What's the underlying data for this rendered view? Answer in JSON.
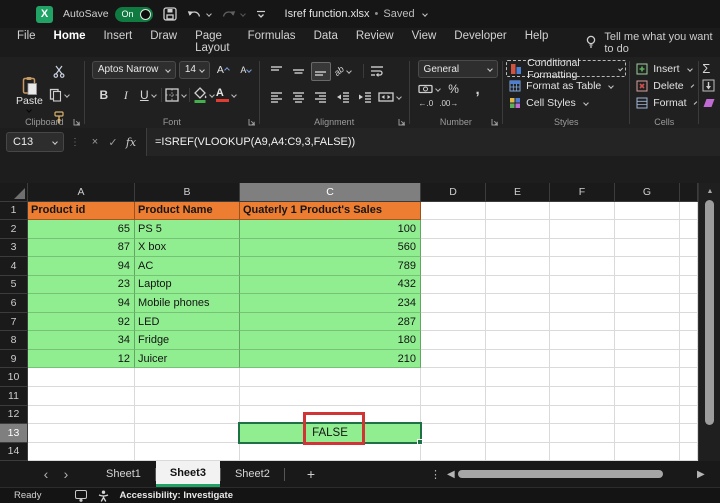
{
  "titlebar": {
    "autosave_label": "AutoSave",
    "autosave_state": "On",
    "doc_title": "Isref function.xlsx",
    "dot": "•",
    "save_status": "Saved"
  },
  "menubar": {
    "tabs": [
      "File",
      "Home",
      "Insert",
      "Draw",
      "Page Layout",
      "Formulas",
      "Data",
      "Review",
      "View",
      "Developer",
      "Help"
    ],
    "active_tab": "Home",
    "tell_me": "Tell me what you want to do"
  },
  "ribbon": {
    "clipboard": {
      "paste_label": "Paste",
      "group_label": "Clipboard"
    },
    "font": {
      "font_name": "Aptos Narrow",
      "font_size": "14",
      "bold": "B",
      "italic": "I",
      "underline": "U",
      "group_label": "Font"
    },
    "alignment": {
      "group_label": "Alignment"
    },
    "number": {
      "format": "General",
      "percent": "%",
      "comma": ",",
      "group_label": "Number"
    },
    "styles": {
      "conditional_formatting": "Conditional Formatting",
      "format_as_table": "Format as Table",
      "cell_styles": "Cell Styles",
      "group_label": "Styles"
    },
    "cells": {
      "insert": "Insert",
      "delete": "Delete",
      "format": "Format",
      "group_label": "Cells"
    },
    "editing": {
      "autosum_glyph": "Σ"
    }
  },
  "formula_bar": {
    "name_box": "C13",
    "cancel_glyph": "×",
    "enter_glyph": "✓",
    "fx": "fx",
    "formula": "=ISREF(VLOOKUP(A9,A4:C9,3,FALSE))"
  },
  "grid": {
    "column_letters": [
      "A",
      "B",
      "C",
      "D",
      "E",
      "F",
      "G"
    ],
    "selected_column": "C",
    "selected_row": 13,
    "row_count": 14,
    "header_row": [
      "Product id",
      "Product Name",
      "Quaterly 1 Product's Sales"
    ],
    "products": [
      {
        "id": "65",
        "name": "PS 5",
        "sales": "100"
      },
      {
        "id": "87",
        "name": "X box",
        "sales": "560"
      },
      {
        "id": "94",
        "name": "AC",
        "sales": "789"
      },
      {
        "id": "23",
        "name": "Laptop",
        "sales": "432"
      },
      {
        "id": "94",
        "name": "Mobile phones",
        "sales": "234"
      },
      {
        "id": "92",
        "name": "LED",
        "sales": "287"
      },
      {
        "id": "34",
        "name": "Fridge",
        "sales": "180"
      },
      {
        "id": "12",
        "name": "Juicer",
        "sales": "210"
      }
    ],
    "result_cell": {
      "ref": "C13",
      "value": "FALSE"
    }
  },
  "sheet_tabs": {
    "tabs": [
      "Sheet1",
      "Sheet3",
      "Sheet2"
    ],
    "active": "Sheet3",
    "add_glyph": "+"
  },
  "status_bar": {
    "mode": "Ready",
    "accessibility": "Accessibility: Investigate"
  },
  "icons": {
    "orientation": "ab",
    "font_grow": "A",
    "font_shrink": "A",
    "increase_decimal": "←.0",
    "decrease_decimal": ".00→",
    "more_dots": "⋮",
    "fbar_dots": "⋮",
    "nav_prev": "‹",
    "nav_next": "›",
    "scroll_left": "◀",
    "scroll_right": "▶",
    "scroll_up": "▲",
    "fill_down_note": "↓"
  },
  "colors": {
    "header_fill": "#ED7D31",
    "data_fill": "#90EE90",
    "accent_green": "#21A366",
    "annotation_red": "#D03434",
    "selected_header_bg": "#7f7f7f",
    "selection_border": "#1E7145"
  }
}
